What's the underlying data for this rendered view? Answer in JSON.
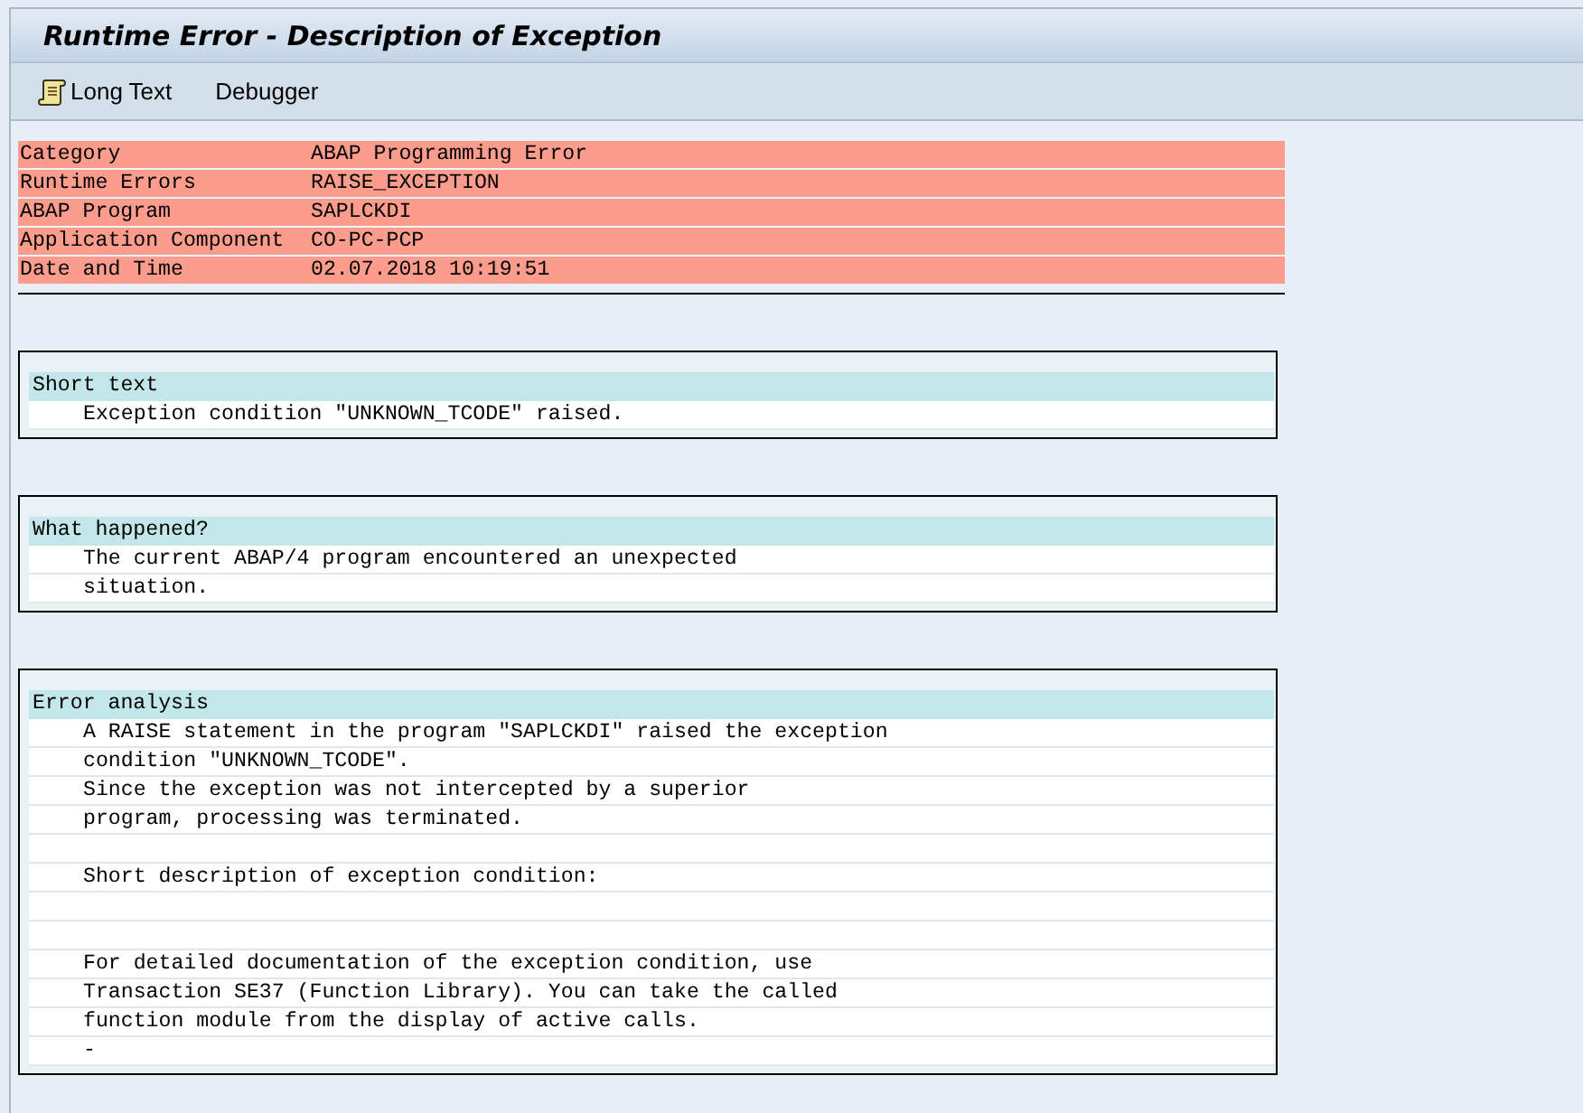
{
  "window": {
    "title": "Runtime Error - Description of Exception"
  },
  "toolbar": {
    "buttons": [
      {
        "kind": "with_icon",
        "label": "Long Text"
      },
      {
        "kind": "plain",
        "label": "Debugger"
      }
    ]
  },
  "summary": [
    {
      "label": "Category",
      "value": "ABAP Programming Error"
    },
    {
      "label": "Runtime Errors",
      "value": "RAISE_EXCEPTION"
    },
    {
      "label": "ABAP Program",
      "value": "SAPLCKDI"
    },
    {
      "label": "Application Component",
      "value": "CO-PC-PCP"
    },
    {
      "label": "Date and Time",
      "value": "02.07.2018 10:19:51"
    }
  ],
  "sections": [
    {
      "heading": "Short text",
      "lines": [
        {
          "kind": "text",
          "text": "Exception condition \"UNKNOWN_TCODE\" raised."
        }
      ]
    },
    {
      "heading": "What happened?",
      "lines": [
        {
          "kind": "text",
          "text": "The current ABAP/4 program encountered an unexpected"
        },
        {
          "kind": "text",
          "text": "situation."
        }
      ]
    },
    {
      "heading": "Error analysis",
      "lines": [
        {
          "kind": "text",
          "text": "A RAISE statement in the program \"SAPLCKDI\" raised the exception"
        },
        {
          "kind": "text",
          "text": "condition \"UNKNOWN_TCODE\"."
        },
        {
          "kind": "text",
          "text": "Since the exception was not intercepted by a superior"
        },
        {
          "kind": "text",
          "text": "program, processing was terminated."
        },
        {
          "kind": "blank"
        },
        {
          "kind": "text",
          "text": "Short description of exception condition:"
        },
        {
          "kind": "blank"
        },
        {
          "kind": "blank"
        },
        {
          "kind": "text",
          "text": "For detailed documentation of the exception condition, use"
        },
        {
          "kind": "text",
          "text": "Transaction SE37 (Function Library). You can take the called"
        },
        {
          "kind": "text",
          "text": "function module from the display of active calls."
        },
        {
          "kind": "text",
          "text": "-"
        }
      ]
    }
  ]
}
